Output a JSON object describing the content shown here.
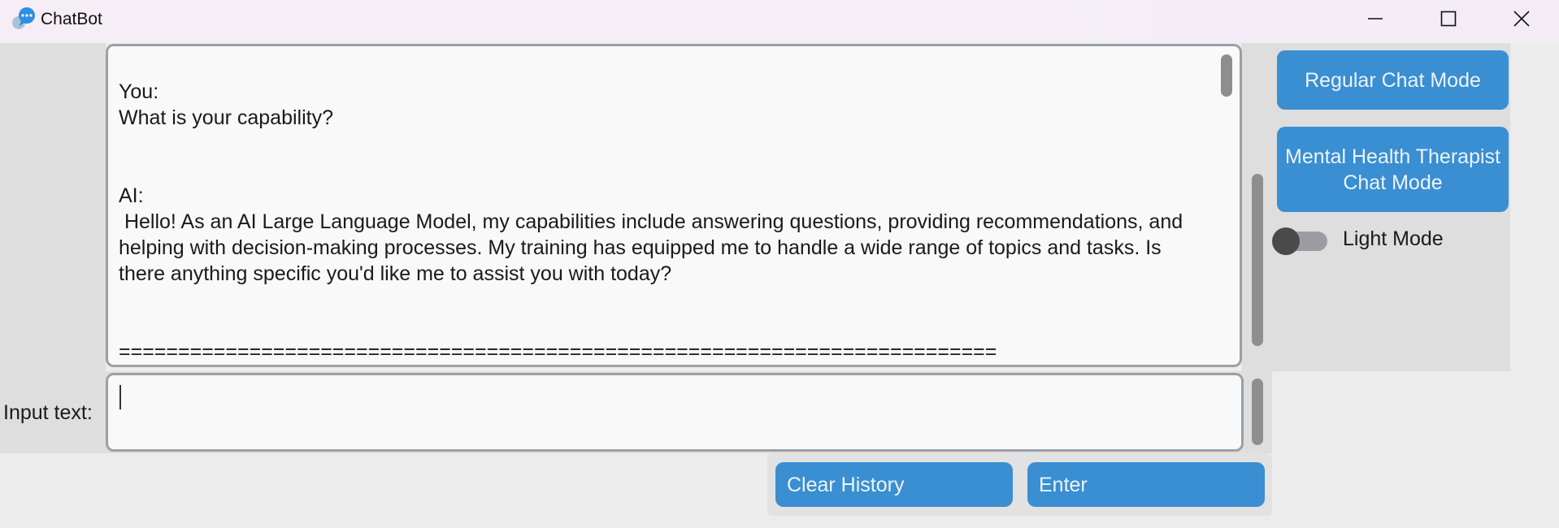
{
  "window": {
    "title": "ChatBot",
    "icon": "chat-bubble-icon",
    "controls": [
      "minimize-icon",
      "maximize-icon",
      "close-icon"
    ]
  },
  "chat": {
    "transcript": "You:\nWhat is your capability?\n\n\nAI:\n Hello! As an AI Large Language Model, my capabilities include answering questions, providing recommendations, and helping with decision-making processes. My training has equipped me to handle a wide range of topics and tasks. Is there anything specific you'd like me to assist you with today?\n\n\n=========================================================================="
  },
  "input": {
    "label": "Input text:",
    "value": ""
  },
  "sidebar": {
    "regular_mode_label": "Regular Chat Mode",
    "therapist_mode_label": "Mental Health Therapist Chat Mode",
    "theme_toggle_label": "Light Mode",
    "theme_toggle_on": false
  },
  "footer": {
    "clear_label": "Clear History",
    "enter_label": "Enter"
  },
  "colors": {
    "accent": "#3a8ed2",
    "panel": "#dedede",
    "background": "#ececec"
  }
}
